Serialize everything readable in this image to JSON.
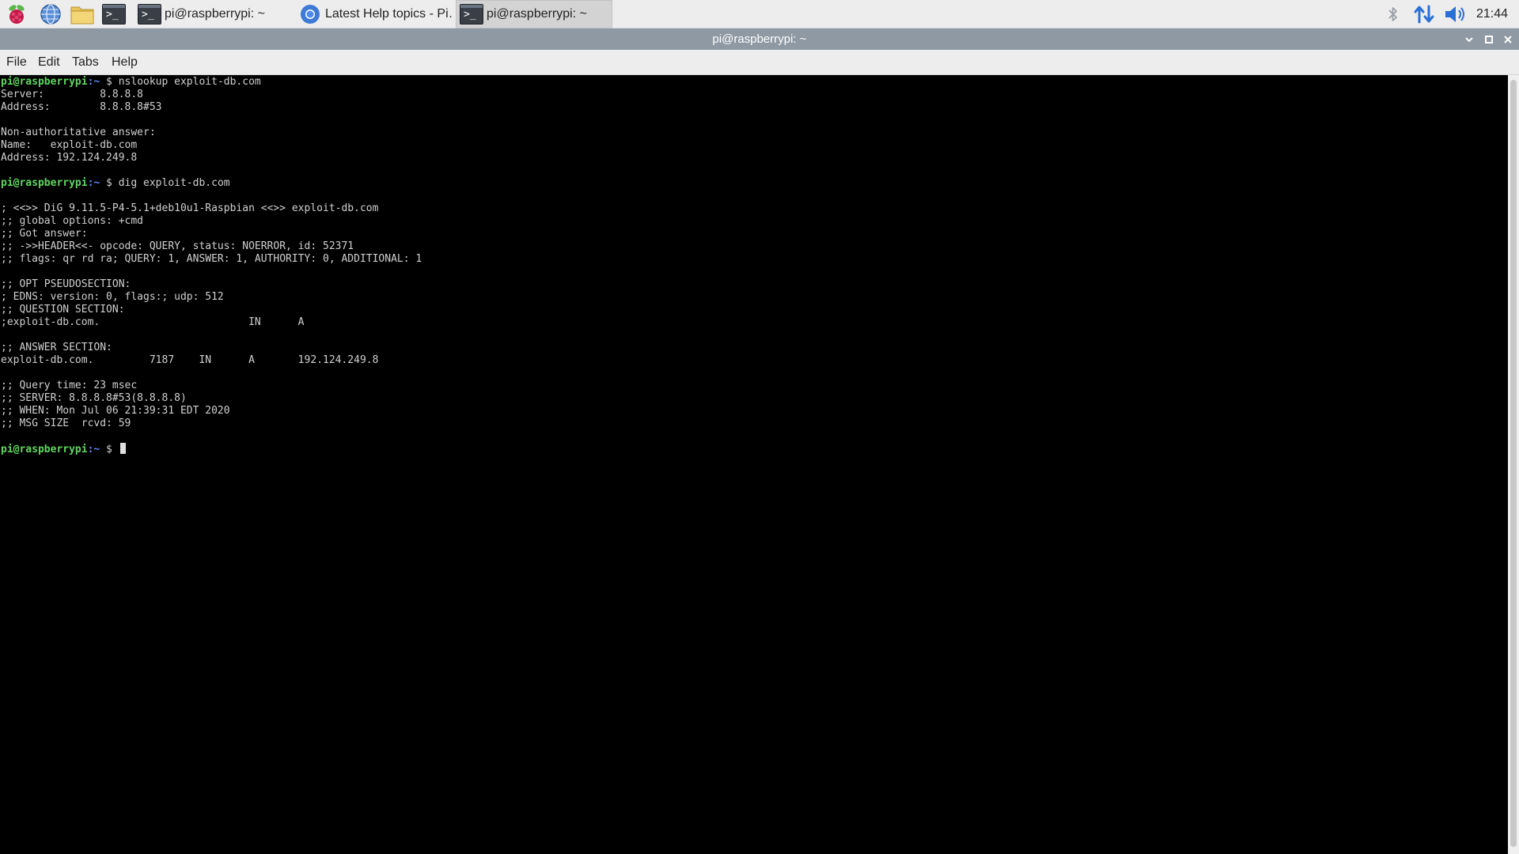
{
  "taskbar": {
    "launchers": [
      {
        "name": "raspberry-menu-icon"
      },
      {
        "name": "web-browser-icon"
      },
      {
        "name": "file-manager-icon"
      },
      {
        "name": "terminal-launcher-icon"
      }
    ],
    "tasks": [
      {
        "label": "pi@raspberrypi: ~",
        "icon": "terminal-icon",
        "active": false
      },
      {
        "label": "Latest Help topics - Pi…",
        "icon": "chromium-icon",
        "active": false
      },
      {
        "label": "pi@raspberrypi: ~",
        "icon": "terminal-icon",
        "active": true
      }
    ],
    "terminal_glyph": ">_",
    "tray": {
      "icons": [
        "bluetooth-icon",
        "network-icon",
        "volume-icon"
      ]
    },
    "clock": "21:44"
  },
  "window": {
    "title": "pi@raspberrypi: ~",
    "controls": [
      "minimize-icon",
      "maximize-icon",
      "close-icon"
    ]
  },
  "menu": {
    "file": "File",
    "edit": "Edit",
    "tabs": "Tabs",
    "help": "Help"
  },
  "terminal": {
    "prompt_user": "pi@raspberrypi",
    "prompt_path": ":~",
    "prompt_sign": " $ ",
    "commands": [
      "nslookup exploit-db.com",
      "dig exploit-db.com"
    ],
    "output_nslookup": [
      "Server:         8.8.8.8",
      "Address:        8.8.8.8#53",
      "",
      "Non-authoritative answer:",
      "Name:   exploit-db.com",
      "Address: 192.124.249.8",
      ""
    ],
    "output_dig": [
      "",
      "; <<>> DiG 9.11.5-P4-5.1+deb10u1-Raspbian <<>> exploit-db.com",
      ";; global options: +cmd",
      ";; Got answer:",
      ";; ->>HEADER<<- opcode: QUERY, status: NOERROR, id: 52371",
      ";; flags: qr rd ra; QUERY: 1, ANSWER: 1, AUTHORITY: 0, ADDITIONAL: 1",
      "",
      ";; OPT PSEUDOSECTION:",
      "; EDNS: version: 0, flags:; udp: 512",
      ";; QUESTION SECTION:",
      ";exploit-db.com.                        IN      A",
      "",
      ";; ANSWER SECTION:",
      "exploit-db.com.         7187    IN      A       192.124.249.8",
      "",
      ";; Query time: 23 msec",
      ";; SERVER: 8.8.8.8#53(8.8.8.8)",
      ";; WHEN: Mon Jul 06 21:39:31 EDT 2020",
      ";; MSG SIZE  rcvd: 59",
      ""
    ]
  },
  "colors": {
    "prompt_user": "#5fd75f",
    "prompt_path": "#5f87ff",
    "output_text": "#d0d0d0",
    "terminal_bg": "#000000",
    "titlebar_bg": "#8e99a3",
    "taskbar_bg": "#ededed"
  }
}
